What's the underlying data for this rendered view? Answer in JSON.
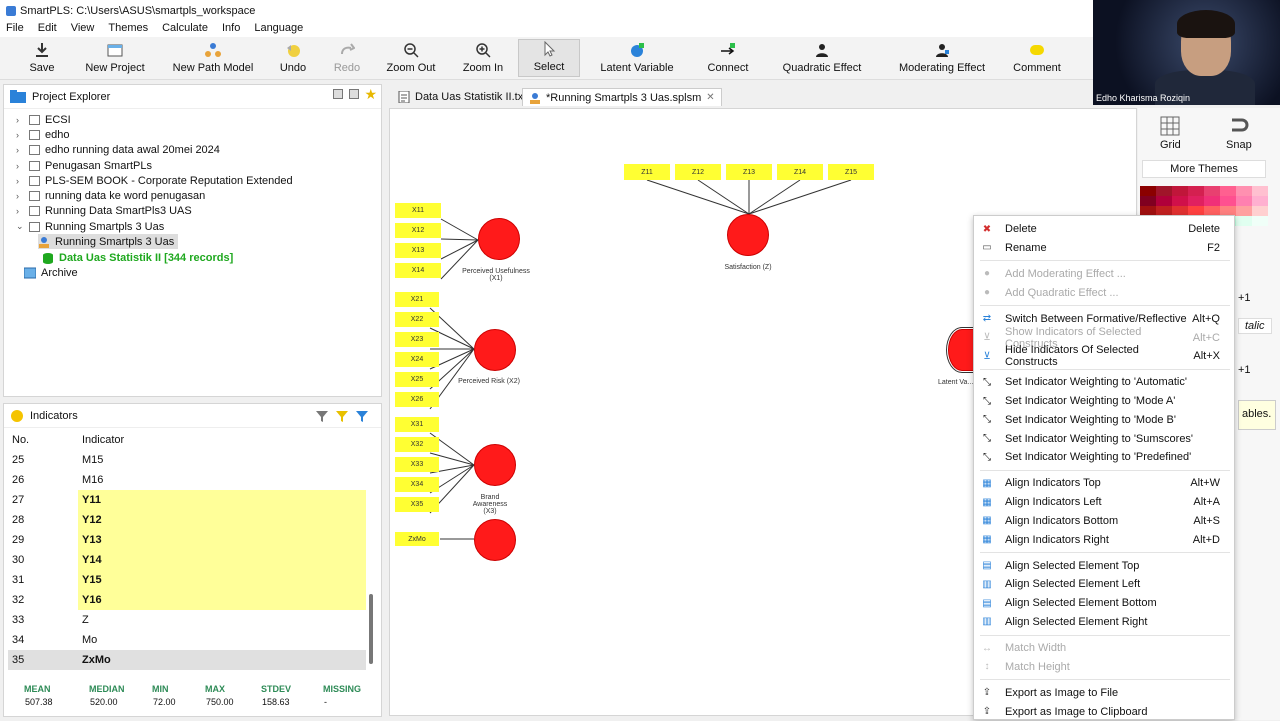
{
  "window": {
    "title": "SmartPLS: C:\\Users\\ASUS\\smartpls_workspace"
  },
  "menu": [
    "File",
    "Edit",
    "View",
    "Themes",
    "Calculate",
    "Info",
    "Language"
  ],
  "toolbar": {
    "save": "Save",
    "new_project": "New Project",
    "new_path_model": "New Path Model",
    "undo": "Undo",
    "redo": "Redo",
    "zoom_out": "Zoom Out",
    "zoom_in": "Zoom In",
    "select": "Select",
    "latent_variable": "Latent Variable",
    "connect": "Connect",
    "quadratic_effect": "Quadratic Effect",
    "moderating_effect": "Moderating Effect",
    "comment": "Comment"
  },
  "webcam": {
    "name": "Edho Kharisma Roziqin"
  },
  "project_explorer": {
    "title": "Project Explorer",
    "items": [
      {
        "label": "ECSI",
        "level": 0,
        "expanded": false
      },
      {
        "label": "edho",
        "level": 0,
        "expanded": false
      },
      {
        "label": "edho running data awal 20mei 2024",
        "level": 0,
        "expanded": false
      },
      {
        "label": "Penugasan SmartPLs",
        "level": 0,
        "expanded": false
      },
      {
        "label": "PLS-SEM BOOK - Corporate Reputation Extended",
        "level": 0,
        "expanded": false
      },
      {
        "label": "running data ke word penugasan",
        "level": 0,
        "expanded": false
      },
      {
        "label": "Running Data SmartPls3 UAS",
        "level": 0,
        "expanded": false
      },
      {
        "label": "Running Smartpls 3 Uas",
        "level": 0,
        "expanded": true
      },
      {
        "label": "Running Smartpls 3 Uas",
        "level": 1,
        "selected": true
      },
      {
        "label": "Data Uas Statistik II [344 records]",
        "level": 1,
        "dataset": true
      },
      {
        "label": "Archive",
        "level": 0,
        "archive": true
      }
    ]
  },
  "indicators": {
    "title": "Indicators",
    "col_no": "No.",
    "col_indicator": "Indicator",
    "rows": [
      {
        "no": "25",
        "name": "M15",
        "highlight": false,
        "bold": false
      },
      {
        "no": "26",
        "name": "M16",
        "highlight": false,
        "bold": false
      },
      {
        "no": "27",
        "name": "Y11",
        "highlight": true,
        "bold": true
      },
      {
        "no": "28",
        "name": "Y12",
        "highlight": true,
        "bold": true
      },
      {
        "no": "29",
        "name": "Y13",
        "highlight": true,
        "bold": true
      },
      {
        "no": "30",
        "name": "Y14",
        "highlight": true,
        "bold": true
      },
      {
        "no": "31",
        "name": "Y15",
        "highlight": true,
        "bold": true
      },
      {
        "no": "32",
        "name": "Y16",
        "highlight": true,
        "bold": true
      },
      {
        "no": "33",
        "name": "Z",
        "highlight": false,
        "bold": false
      },
      {
        "no": "34",
        "name": "Mo",
        "highlight": false,
        "bold": false
      },
      {
        "no": "35",
        "name": "ZxMo",
        "highlight": false,
        "bold": true,
        "selected": true
      }
    ],
    "stats_headers": [
      "MEAN",
      "MEDIAN",
      "MIN",
      "MAX",
      "STDEV",
      "MISSING"
    ],
    "stats_values": [
      "507.38",
      "520.00",
      "72.00",
      "750.00",
      "158.63",
      "-"
    ]
  },
  "tabs": [
    {
      "label": "Data Uas Statistik II.txt",
      "active": false
    },
    {
      "label": "*Running Smartpls 3 Uas.splsm",
      "active": true
    }
  ],
  "model": {
    "z_indicators": [
      "Z11",
      "Z12",
      "Z13",
      "Z14",
      "Z15"
    ],
    "x1_indicators": [
      "X11",
      "X12",
      "X13",
      "X14"
    ],
    "x2_indicators": [
      "X21",
      "X22",
      "X23",
      "X24",
      "X25",
      "X26"
    ],
    "x3_indicators": [
      "X31",
      "X32",
      "X33",
      "X34",
      "X35"
    ],
    "zxmo_indicator": "ZxMo",
    "constructs": {
      "satisfaction": "Satisfaction (Z)",
      "x1": "Perceived Usefulness (X1)",
      "x2": "Perceived Risk (X2)",
      "x3": "Brand Awareness (X3)",
      "zxmo": "Z*Mo",
      "latent": "Latent Va..."
    }
  },
  "right_panel": {
    "grid": "Grid",
    "snap": "Snap",
    "more_themes": "More Themes",
    "partial_1": "+1",
    "partial_italic": "talic",
    "partial_2": "+1",
    "partial_tooltip": "ables."
  },
  "context_menu": [
    {
      "label": "Delete",
      "shortcut": "Delete",
      "icon": "delete-icon",
      "disabled": false
    },
    {
      "label": "Rename",
      "shortcut": "F2",
      "icon": "rename-icon",
      "disabled": false
    },
    {
      "sep": true
    },
    {
      "label": "Add Moderating Effect ...",
      "shortcut": "",
      "icon": "moderating-icon",
      "disabled": true
    },
    {
      "label": "Add Quadratic Effect ...",
      "shortcut": "",
      "icon": "quadratic-icon",
      "disabled": true
    },
    {
      "sep": true
    },
    {
      "label": "Switch Between Formative/Reflective",
      "shortcut": "Alt+Q",
      "icon": "switch-icon",
      "disabled": false
    },
    {
      "label": "Show Indicators of Selected Constructs",
      "shortcut": "Alt+C",
      "icon": "show-indicators-icon",
      "disabled": true
    },
    {
      "label": "Hide Indicators Of Selected Constructs",
      "shortcut": "Alt+X",
      "icon": "hide-indicators-icon",
      "disabled": false
    },
    {
      "sep": true
    },
    {
      "label": "Set Indicator Weighting to 'Automatic'",
      "shortcut": "",
      "icon": "weighting-icon",
      "disabled": false
    },
    {
      "label": "Set Indicator Weighting to 'Mode A'",
      "shortcut": "",
      "icon": "weighting-icon",
      "disabled": false
    },
    {
      "label": "Set Indicator Weighting to 'Mode B'",
      "shortcut": "",
      "icon": "weighting-icon",
      "disabled": false
    },
    {
      "label": "Set Indicator Weighting to 'Sumscores'",
      "shortcut": "",
      "icon": "weighting-icon",
      "disabled": false
    },
    {
      "label": "Set Indicator Weighting to 'Predefined'",
      "shortcut": "",
      "icon": "weighting-icon",
      "disabled": false
    },
    {
      "sep": true
    },
    {
      "label": "Align Indicators Top",
      "shortcut": "Alt+W",
      "icon": "align-top-icon",
      "disabled": false
    },
    {
      "label": "Align Indicators Left",
      "shortcut": "Alt+A",
      "icon": "align-left-icon",
      "disabled": false
    },
    {
      "label": "Align Indicators Bottom",
      "shortcut": "Alt+S",
      "icon": "align-bottom-icon",
      "disabled": false
    },
    {
      "label": "Align Indicators Right",
      "shortcut": "Alt+D",
      "icon": "align-right-icon",
      "disabled": false
    },
    {
      "sep": true
    },
    {
      "label": "Align Selected Element Top",
      "shortcut": "",
      "icon": "align-element-top-icon",
      "disabled": false
    },
    {
      "label": "Align Selected Element Left",
      "shortcut": "",
      "icon": "align-element-left-icon",
      "disabled": false
    },
    {
      "label": "Align Selected Element Bottom",
      "shortcut": "",
      "icon": "align-element-bottom-icon",
      "disabled": false
    },
    {
      "label": "Align Selected Element Right",
      "shortcut": "",
      "icon": "align-element-right-icon",
      "disabled": false
    },
    {
      "sep": true
    },
    {
      "label": "Match Width",
      "shortcut": "",
      "icon": "match-width-icon",
      "disabled": true
    },
    {
      "label": "Match Height",
      "shortcut": "",
      "icon": "match-height-icon",
      "disabled": true
    },
    {
      "sep": true
    },
    {
      "label": "Export as Image to File",
      "shortcut": "",
      "icon": "export-icon",
      "disabled": false
    },
    {
      "label": "Export as Image to Clipboard",
      "shortcut": "",
      "icon": "export-icon",
      "disabled": false
    }
  ],
  "colors": {
    "indicator_fill": "#ffff33",
    "construct_fill": "#ff1a1a",
    "highlight_row": "#ffff99",
    "stats_header": "#2e8b57"
  }
}
